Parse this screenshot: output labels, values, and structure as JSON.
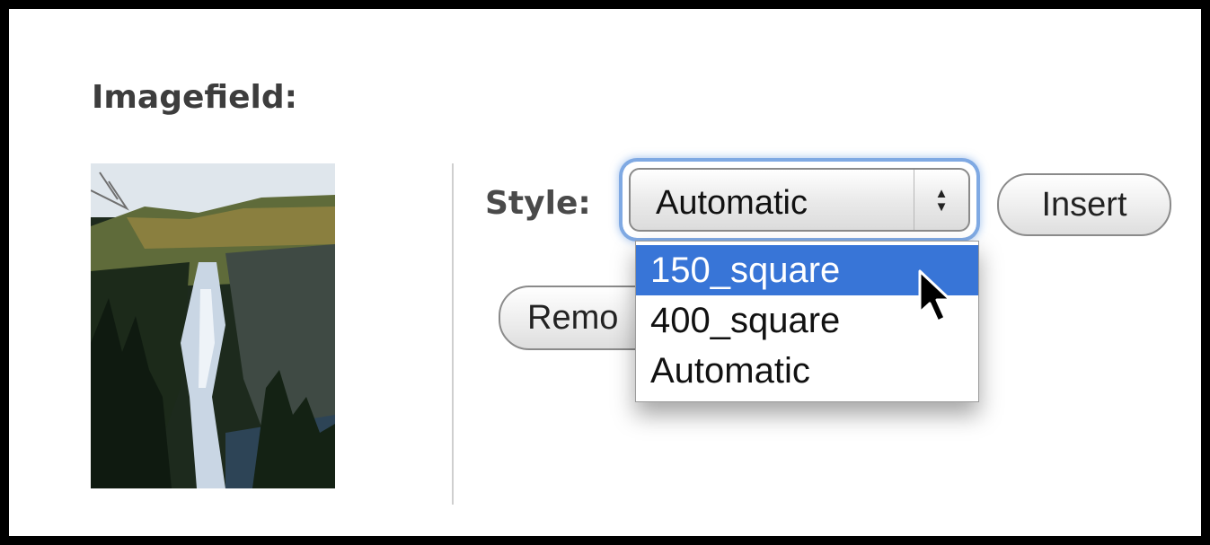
{
  "field": {
    "label": "Imagefield:"
  },
  "thumbnail": {
    "alt": "waterfall-photo"
  },
  "style": {
    "label": "Style:",
    "selected": "Automatic",
    "options": [
      "150_square",
      "400_square",
      "Automatic"
    ],
    "highlighted": "150_square"
  },
  "buttons": {
    "insert": "Insert",
    "remove": "Remo"
  },
  "icons": {
    "select_arrows": "up-down-arrows-icon",
    "cursor": "mouse-pointer-icon"
  },
  "colors": {
    "focus_ring": "#7fa9e3",
    "highlight": "#3875d7"
  }
}
